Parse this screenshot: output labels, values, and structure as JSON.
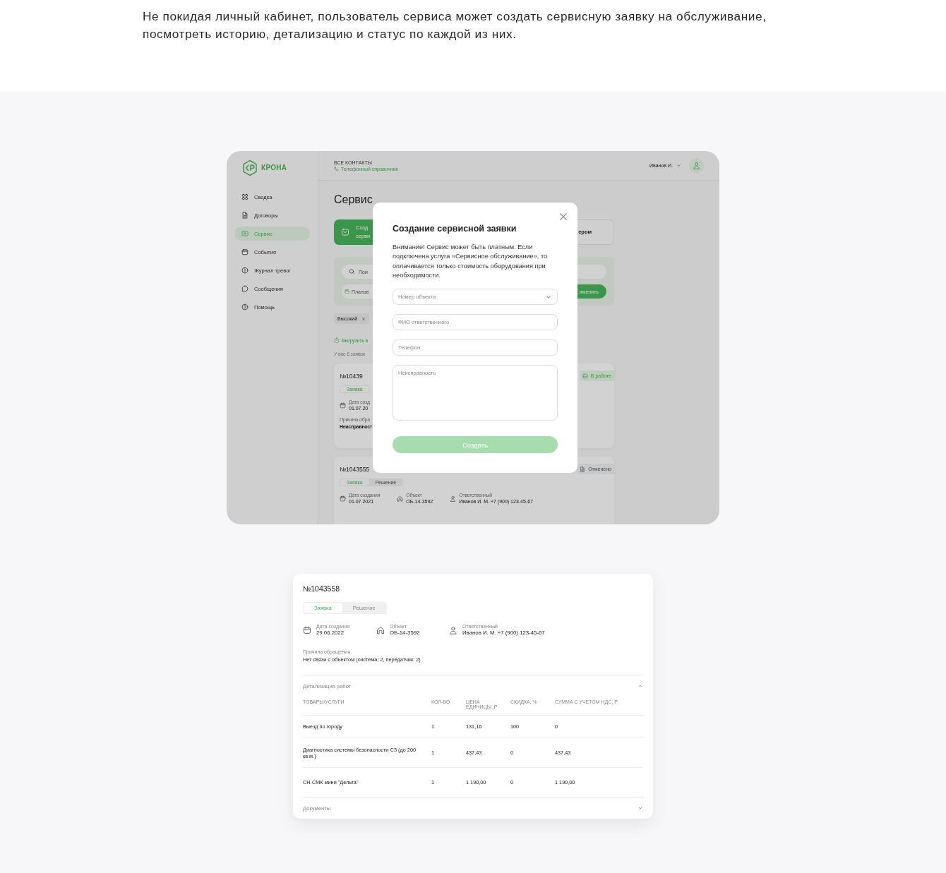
{
  "intro": "Не покидая личный кабинет, пользователь сервиса может создать сервисную заявку на обслуживание, посмотреть историю, детализацию и статус по каждой из них.",
  "app": {
    "logo": "КРОНА",
    "sidebar": {
      "items": [
        {
          "label": "Сводка",
          "selected": false
        },
        {
          "label": "Договоры",
          "selected": false
        },
        {
          "label": "Сервис",
          "selected": true
        },
        {
          "label": "События",
          "selected": false
        },
        {
          "label": "Журнал тревог",
          "selected": false
        },
        {
          "label": "Сообщения",
          "selected": false
        },
        {
          "label": "Помощь",
          "selected": false
        }
      ]
    },
    "header": {
      "contacts_label": "ВСЕ КОНТАКТЫ",
      "phone_book_link": "Телефонный справочник",
      "user_name": "Иванов И."
    },
    "page_title": "Сервис",
    "actions": [
      {
        "kind": "primary",
        "lines": [
          "Созд",
          "серви"
        ]
      },
      {
        "kind": "secondary",
        "lines": [
          "ером"
        ]
      }
    ],
    "filters": {
      "search_placeholder": "Пои",
      "date_placeholder": "Планов",
      "apply_button": "именить"
    },
    "chips": [
      {
        "label": "Высокий",
        "removable": true
      }
    ],
    "export_link": "Выгрузить в",
    "request_count": "У вас 6 заявок",
    "requests": [
      {
        "number": "№10439",
        "tabs": [
          {
            "label": "Заявка",
            "selected": true
          }
        ],
        "fields": [
          {
            "kind": "date",
            "label": "Дата созд",
            "value": "01.07.20"
          }
        ],
        "reason_label": "Причина обра",
        "reason": "Неисправност",
        "status": {
          "kind": "in_progress",
          "label": "В работе"
        }
      },
      {
        "number": "№1043555",
        "tabs": [
          {
            "label": "Заявка",
            "selected": true
          },
          {
            "label": "Решение",
            "selected": false
          }
        ],
        "fields": [
          {
            "kind": "date",
            "label": "Дата создания",
            "value": "01.07.2021"
          },
          {
            "kind": "object",
            "label": "Объект",
            "value": "ОБ-14-3592"
          },
          {
            "kind": "person",
            "label": "Ответственный",
            "value": "Иванов И. М. +7 (900) 123-45-67"
          }
        ],
        "status": {
          "kind": "cancelled",
          "label": "Отменено"
        }
      }
    ]
  },
  "modal": {
    "title": "Создание сервисной заявки",
    "notice": "Внимание! Сервис может быть платным. Если подключена услуга «Сервисное обслуживание», то оплачивается только стоимость оборудования при необходимости.",
    "fields": [
      {
        "kind": "select",
        "placeholder": "Номер объекта"
      },
      {
        "kind": "input",
        "placeholder": "ФИО ответственного"
      },
      {
        "kind": "input",
        "placeholder": "Телефон"
      },
      {
        "kind": "textarea",
        "placeholder": "Неисправность"
      }
    ],
    "submit": {
      "label": "Создать",
      "disabled": true
    }
  },
  "detail": {
    "number": "№1043558",
    "tabs": [
      {
        "label": "Заявка",
        "selected": true
      },
      {
        "label": "Решение",
        "selected": false
      }
    ],
    "fields": [
      {
        "kind": "date",
        "label": "Дата создания",
        "value": "29.06.2022"
      },
      {
        "kind": "object",
        "label": "Объект",
        "value": "ОБ-14-3592"
      },
      {
        "kind": "person",
        "label": "Ответственный",
        "value": "Иванов И. М. +7 (900) 123-45-67"
      }
    ],
    "reason_label": "Причина обращения",
    "reason": "Нет связи с объектом (система: 2, передатчик: 2)",
    "sections": [
      {
        "title": "Детализация работ",
        "expanded": true,
        "table": {
          "columns": [
            "ТОВАРЫ/УСЛУГИ",
            "КОЛ-ВО",
            "ЦЕНА ЕДИНИЦЫ, Р",
            "СКИДКА, %",
            "СУММА С УЧЕТОМ НДС, Р"
          ],
          "rows": [
            [
              "Выезд по городу",
              "1",
              "131,16",
              "100",
              "0"
            ],
            [
              "Диагностика системы безопасности СЗ (до 200 кв.м.)",
              "1",
              "437,43",
              "0",
              "437,43"
            ],
            [
              "СН-СМК мини \"Дельта\"",
              "1",
              "1 190,00",
              "0",
              "1 190,00"
            ]
          ]
        }
      },
      {
        "title": "Документы",
        "expanded": false
      }
    ]
  }
}
